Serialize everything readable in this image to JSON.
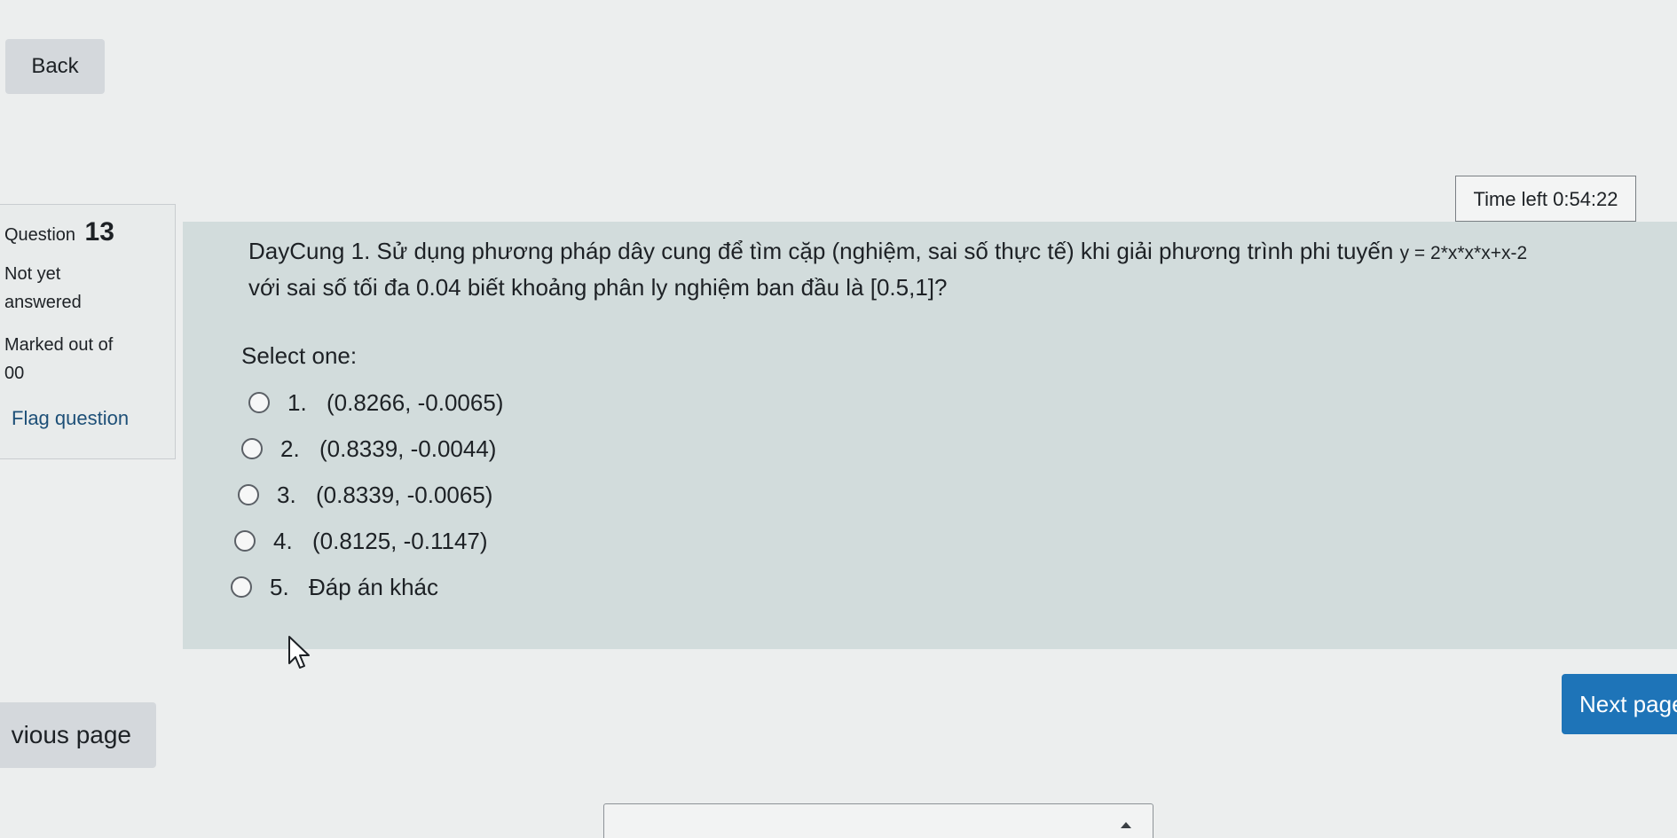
{
  "nav": {
    "back_label": "Back",
    "prev_label": "vious page",
    "next_label": "Next page"
  },
  "timer": {
    "text": "Time left 0:54:22"
  },
  "question_info": {
    "question_label": "Question",
    "question_number": "13",
    "status_line1": "Not yet",
    "status_line2": "answered",
    "marked_line1": "Marked out of",
    "marked_line2": "00",
    "flag_label": "Flag question"
  },
  "question": {
    "text_part1": "DayCung 1. Sử dụng phương pháp dây cung để tìm cặp (nghiệm, sai số thực tế) khi giải phương trình phi tuyến ",
    "formula": "y = 2*x*x*x+x-2",
    "text_part2": "với sai số tối đa 0.04 biết khoảng phân ly nghiệm ban đầu là ",
    "interval": "[0.5,1]",
    "text_end": "?",
    "select_label": "Select one:",
    "answers": [
      {
        "num": "1.",
        "text": "(0.8266, -0.0065)"
      },
      {
        "num": "2.",
        "text": "(0.8339, -0.0044)"
      },
      {
        "num": "3.",
        "text": "(0.8339, -0.0065)"
      },
      {
        "num": "4.",
        "text": "(0.8125, -0.1147)"
      },
      {
        "num": "5.",
        "text": "Đáp án khác"
      }
    ]
  },
  "colors": {
    "accent": "#1e74b8",
    "content_bg": "#d2dcdc"
  }
}
